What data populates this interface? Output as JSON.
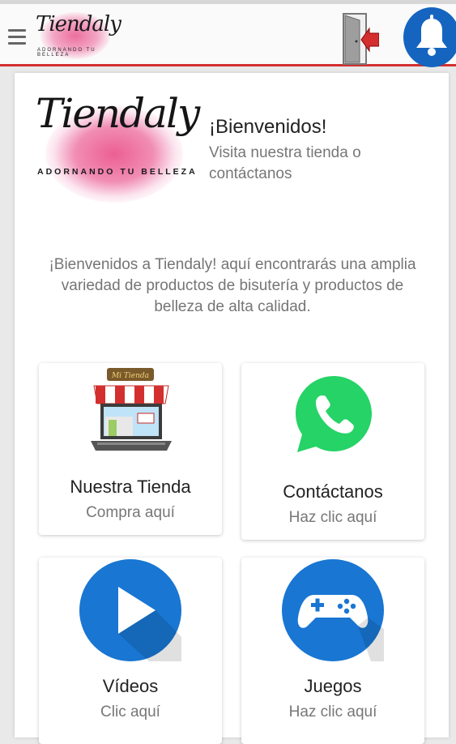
{
  "header": {
    "logo_name": "Tiendaly",
    "logo_tagline": "ADORNANDO TU BELLEZA",
    "menu_icon": "hamburger-menu-icon",
    "exit_icon": "exit-door-icon",
    "notification_icon": "bell-icon",
    "accent_color": "#d32f2f",
    "bell_color": "#1565c0"
  },
  "hero": {
    "logo_name": "Tiendaly",
    "logo_tagline": "ADORNANDO TU BELLEZA",
    "title": "¡Bienvenidos!",
    "subtitle": "Visita nuestra tienda o contáctanos"
  },
  "intro_text": "¡Bienvenidos a Tiendaly! aquí encontrarás una amplia variedad de productos de bisutería y productos de belleza de alta calidad.",
  "tiles": [
    {
      "title": "Nuestra Tienda",
      "subtitle": "Compra aquí",
      "icon": "storefront-laptop-icon",
      "sign": "Mi Tienda"
    },
    {
      "title": "Contáctanos",
      "subtitle": "Haz clic aquí",
      "icon": "whatsapp-icon",
      "color": "#25d366"
    },
    {
      "title": "Vídeos",
      "subtitle": "Clic aquí",
      "icon": "play-icon",
      "color": "#1976d2"
    },
    {
      "title": "Juegos",
      "subtitle": "Haz clic aquí",
      "icon": "gamepad-icon",
      "color": "#1976d2"
    }
  ]
}
